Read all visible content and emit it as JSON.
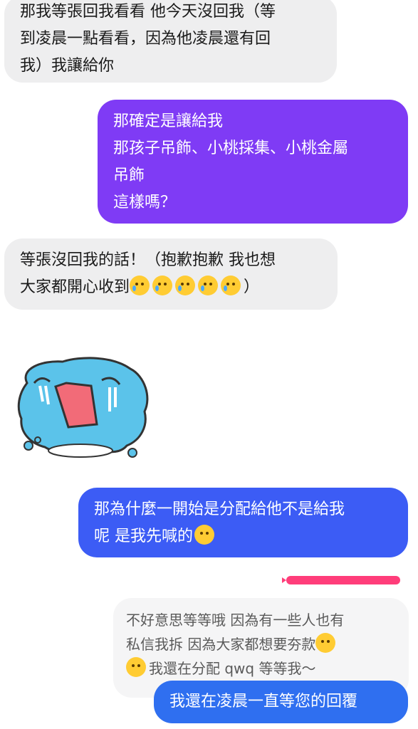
{
  "messages": [
    {
      "id": "m1",
      "dir": "in",
      "lines": [
        "那我等張回我看看 他今天沒回我（等",
        "到凌晨一點看看，因為他凌晨還有回",
        "我）我讓給你"
      ]
    },
    {
      "id": "m2",
      "dir": "out",
      "color": "#7f3bf5",
      "lines": [
        "那確定是讓給我",
        "那孩子吊飾、小桃採集、小桃金屬",
        "吊飾",
        "這樣嗎？"
      ]
    },
    {
      "id": "m3",
      "dir": "in",
      "lines": [
        "等張沒回我的話！（抱歉抱歉 我也想",
        "大家都開心收到"
      ],
      "line2_suffix": "）",
      "emoji_count": 5
    },
    {
      "id": "m4",
      "dir": "out",
      "color": "#3c5cf5",
      "lines": [
        "那為什麼一開始是分配給他不是給我",
        "呢 是我先喊的"
      ]
    },
    {
      "id": "m5",
      "dir": "in",
      "quoted": true,
      "lines": [
        "不好意思等等哦 因為有一些人也有",
        "私信我拆 因為大家都想要夯款",
        "我還在分配 qwq 等等我～"
      ]
    },
    {
      "id": "m6",
      "dir": "out",
      "color": "#2f6ff0",
      "lines": [
        "我還在凌晨一直等您的回覆"
      ]
    }
  ],
  "sticker": {
    "name": "crying-blue-creature-sticker",
    "colors": {
      "body": "#5bc3ea",
      "outline": "#3a3a3a",
      "mouth": "#f26b78"
    }
  },
  "icons": {
    "cry": "crying-face-icon",
    "sad": "sad-face-icon",
    "laugh": "rolling-laughing-icon"
  }
}
